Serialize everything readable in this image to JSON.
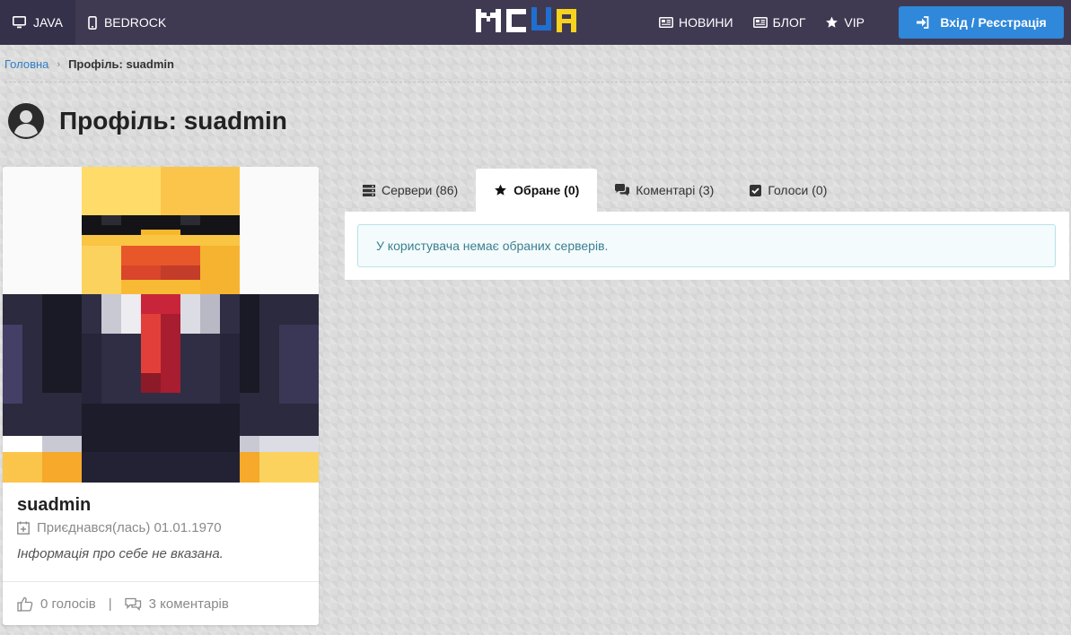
{
  "header": {
    "nav_left": [
      {
        "label": "JAVA",
        "icon": "monitor-icon",
        "active": true
      },
      {
        "label": "BEDROCK",
        "icon": "phone-icon",
        "active": false
      }
    ],
    "logo_text": "MCUA",
    "nav_right": [
      {
        "label": "НОВИНИ",
        "icon": "newspaper-icon"
      },
      {
        "label": "БЛОГ",
        "icon": "newspaper-icon"
      },
      {
        "label": "VIP",
        "icon": "star-icon"
      }
    ],
    "login_label": "Вхід / Реєстрація"
  },
  "breadcrumb": {
    "home": "Головна",
    "current": "Профіль: suadmin"
  },
  "page_title": "Профіль: suadmin",
  "profile": {
    "username": "suadmin",
    "joined": "Приєднався(лась) 01.01.1970",
    "about": "Інформація про себе не вказана.",
    "votes": "0 голосів",
    "separator": "|",
    "comments": "3 коментарів"
  },
  "tabs": [
    {
      "label": "Сервери (86)",
      "icon": "server-icon",
      "active": false
    },
    {
      "label": "Обране (0)",
      "icon": "star-icon",
      "active": true
    },
    {
      "label": "Коментарі (3)",
      "icon": "comments-icon",
      "active": false
    },
    {
      "label": "Голоси (0)",
      "icon": "checkbox-icon",
      "active": false
    }
  ],
  "panel_message": "У користувача немає обраних серверів.",
  "colors": {
    "topbar": "#3f3a52",
    "accent": "#2f88d9",
    "alert_text": "#3a7f91"
  }
}
